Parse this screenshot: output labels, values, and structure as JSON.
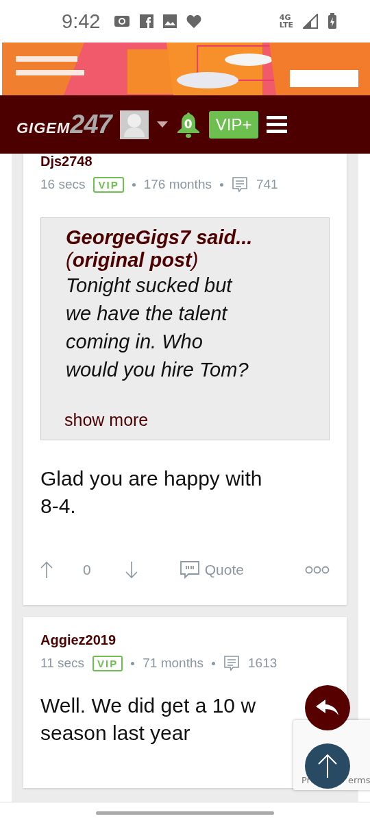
{
  "status_bar": {
    "time": "9:42",
    "network": "4G",
    "network_sub": "LTE"
  },
  "header": {
    "logo_main": "GIGEM",
    "logo_num": "247",
    "notifications": "0",
    "vip_button": "VIP+"
  },
  "posts": [
    {
      "author": "Djs2748",
      "time": "16 secs",
      "badge": "VIP",
      "tenure": "176 months",
      "post_count": "741",
      "quote": {
        "by": "GeorgeGigs7 said...",
        "source": "(**original post**)",
        "lines": [
          "Tonight sucked but",
          "we have the talent",
          "coming in. Who",
          "would you hire Tom?"
        ],
        "more": "show more"
      },
      "lines": [
        "Glad you are happy with",
        "8-4."
      ],
      "actions": {
        "score": "0",
        "quote": "Quote"
      }
    },
    {
      "author": "Aggiez2019",
      "time": "11 secs",
      "badge": "VIP",
      "tenure": "71 months",
      "post_count": "1613",
      "lines": [
        "Well. We did get a 10 w",
        "season last year"
      ]
    }
  ],
  "recaptcha": {
    "left": "Pr",
    "right": "erms"
  }
}
